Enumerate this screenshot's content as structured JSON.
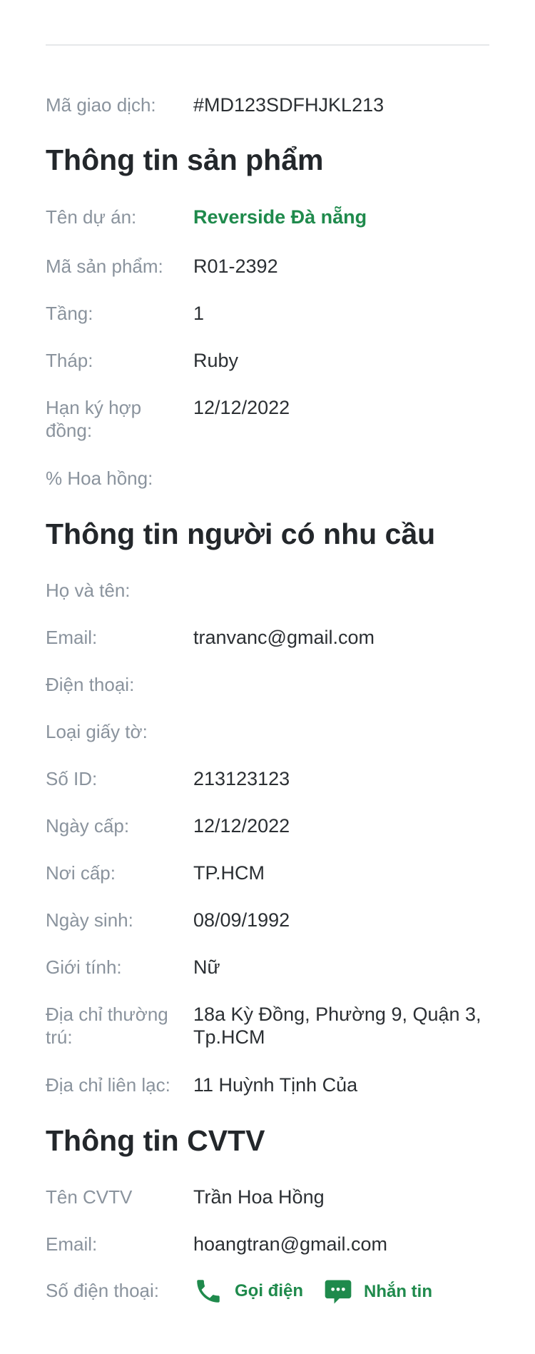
{
  "transaction": {
    "label": "Mã giao dịch:",
    "value": "#MD123SDFHJKL213"
  },
  "product": {
    "heading": "Thông tin sản phẩm",
    "fields": [
      {
        "label": "Tên dự án:",
        "value": "Reverside Đà nẵng",
        "highlight": true
      },
      {
        "label": "Mã sản phẩm:",
        "value": "R01-2392"
      },
      {
        "label": "Tầng:",
        "value": "1"
      },
      {
        "label": "Tháp:",
        "value": "Ruby"
      },
      {
        "label": "Hạn ký hợp đồng:",
        "value": "12/12/2022"
      },
      {
        "label": "% Hoa hồng:",
        "value": ""
      }
    ]
  },
  "customer": {
    "heading": "Thông tin người có nhu cầu",
    "fields": [
      {
        "label": "Họ và tên:",
        "value": ""
      },
      {
        "label": "Email:",
        "value": "tranvanc@gmail.com"
      },
      {
        "label": "Điện thoại:",
        "value": ""
      },
      {
        "label": "Loại giấy tờ:",
        "value": ""
      },
      {
        "label": "Số ID:",
        "value": "213123123"
      },
      {
        "label": "Ngày cấp:",
        "value": "12/12/2022"
      },
      {
        "label": "Nơi cấp:",
        "value": "TP.HCM"
      },
      {
        "label": "Ngày sinh:",
        "value": "08/09/1992"
      },
      {
        "label": "Giới tính:",
        "value": "Nữ"
      },
      {
        "label": "Địa chỉ thường trú:",
        "value": "18a Kỳ Đồng, Phường 9, Quận 3, Tp.HCM"
      },
      {
        "label": "Địa chỉ liên lạc:",
        "value": "11 Huỳnh Tịnh Của"
      }
    ]
  },
  "consultant": {
    "heading": "Thông tin CVTV",
    "fields": [
      {
        "label": "Tên CVTV",
        "value": "Trần Hoa Hồng"
      },
      {
        "label": "Email:",
        "value": "hoangtran@gmail.com"
      }
    ],
    "phone_label": "Số điện thoại:",
    "call_label": "Gọi điện",
    "message_label": "Nhắn tin"
  },
  "colors": {
    "accent": "#1f8a4c",
    "label": "#8a939d",
    "text": "#2b2f33",
    "heading": "#23272b"
  },
  "icons": {
    "call": "phone-icon",
    "message": "chat-bubble-icon"
  }
}
